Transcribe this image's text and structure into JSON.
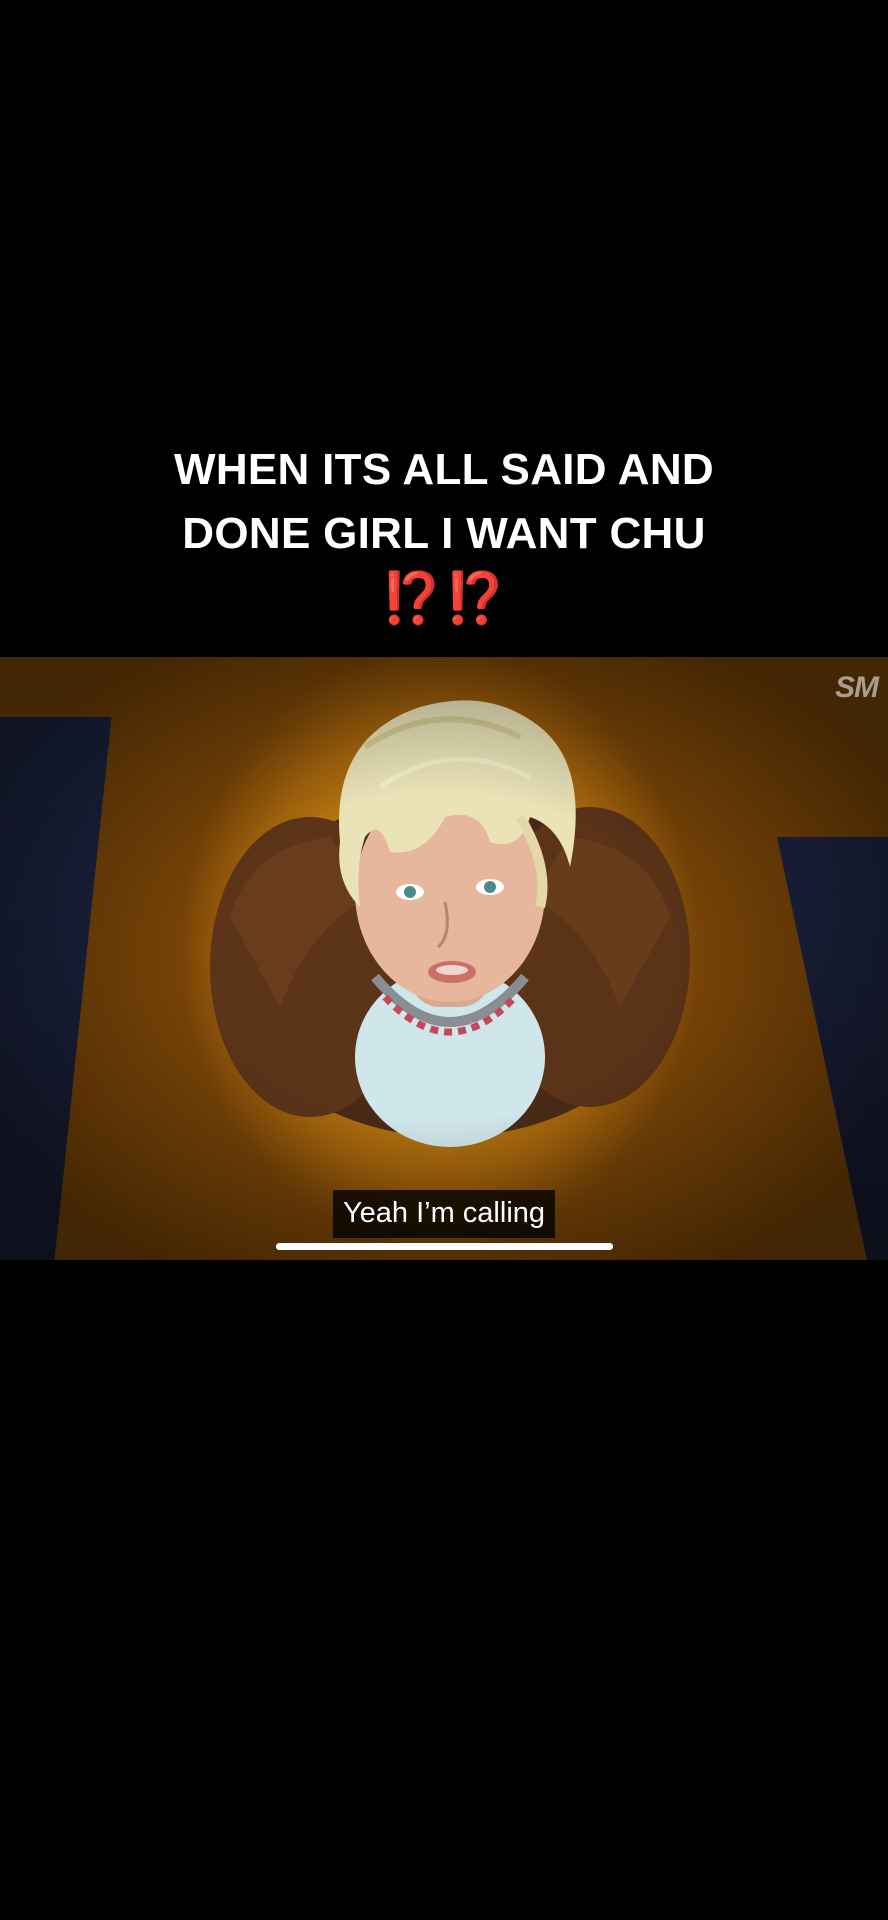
{
  "caption": {
    "line1": "WHEN ITS ALL SAID AND",
    "line2": "DONE GIRL I WANT CHU",
    "emoji": "⁉️⁉️",
    "text_color": "#ffffff",
    "emoji_color": "#e0201d"
  },
  "video": {
    "watermark": "SM",
    "subtitle": "Yeah I’m calling",
    "progress": 1.0,
    "background_color": "#c4820f"
  },
  "icons": {
    "watermark": "sm-logo-icon"
  }
}
